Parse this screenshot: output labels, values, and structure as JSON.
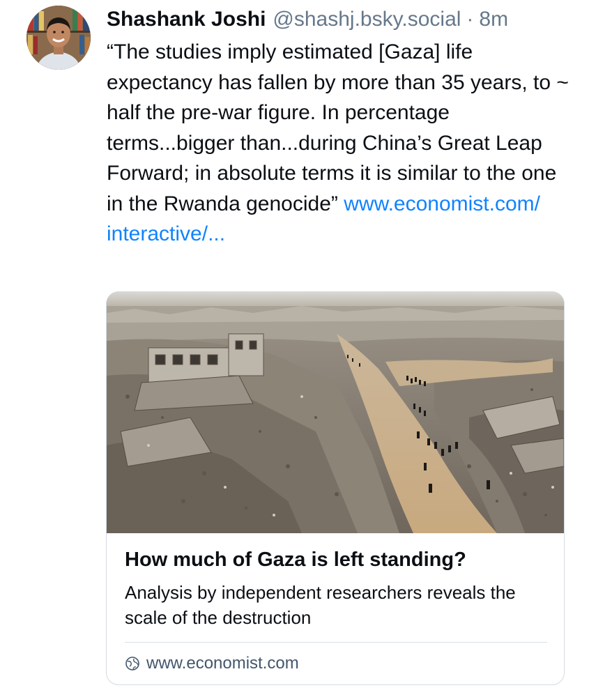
{
  "post": {
    "author_name": "Shashank Joshi",
    "handle": "@shashj.bsky.social",
    "separator": "·",
    "time": "8m",
    "text": "“The studies imply estimated [Gaza] life expectancy has fallen by more than 35 years, to ~ half the pre-war figure. In percentage terms...bigger than...during China’s Great Leap Forward; in absolute terms it is similar to the one in the Rwanda genocide” ",
    "link_text": "www.economist.com/\ninteractive/...",
    "avatar_icon": "author-avatar"
  },
  "embed": {
    "image_icon": "destroyed-buildings-photo",
    "title": "How much of Gaza is left standing?",
    "description": "Analysis by independent researchers reveals the scale of the destruction",
    "domain_icon": "globe-icon",
    "domain": "www.economist.com"
  },
  "colors": {
    "link": "#1083fe",
    "muted": "#66788a",
    "border": "#d4dbe2"
  }
}
